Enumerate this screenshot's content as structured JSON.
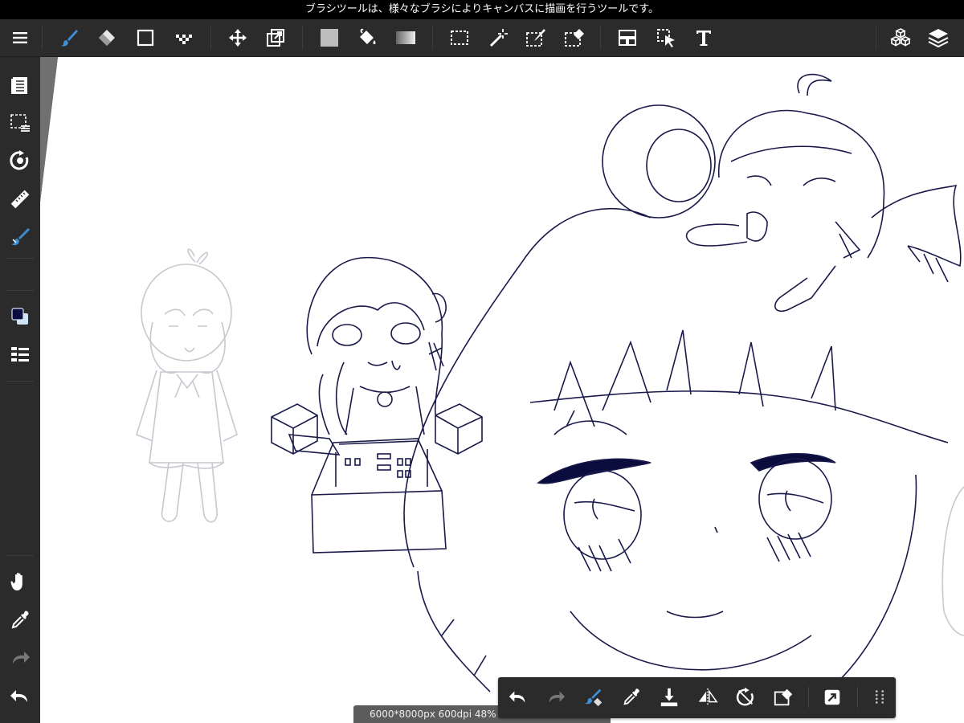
{
  "status_bar": {
    "message": "ブラシツールは、様々なブラシによりキャンバスに描画を行うツールです。"
  },
  "toolbar": {
    "items": [
      {
        "name": "menu-icon"
      },
      {
        "name": "brush-icon",
        "active": true
      },
      {
        "name": "eraser-icon"
      },
      {
        "name": "shape-icon"
      },
      {
        "name": "dot-icon"
      },
      {
        "name": "move-icon"
      },
      {
        "name": "transform-icon"
      },
      {
        "name": "fill-icon"
      },
      {
        "name": "bucket-icon"
      },
      {
        "name": "gradient-icon"
      },
      {
        "name": "select-icon"
      },
      {
        "name": "magic-wand-icon"
      },
      {
        "name": "select-pen-icon"
      },
      {
        "name": "select-eraser-icon"
      },
      {
        "name": "panel-icon"
      },
      {
        "name": "operation-icon"
      },
      {
        "name": "text-icon"
      },
      {
        "name": "material-icon"
      },
      {
        "name": "layers-icon"
      }
    ]
  },
  "sidebar": {
    "items": [
      {
        "name": "pages-icon"
      },
      {
        "name": "selection-list-icon"
      },
      {
        "name": "rotate-canvas-icon"
      },
      {
        "name": "ruler-icon"
      },
      {
        "name": "brush-settings-icon"
      },
      {
        "name": "color-swatch"
      },
      {
        "name": "layer-list-icon"
      },
      {
        "name": "hand-icon"
      },
      {
        "name": "eyedropper-icon"
      },
      {
        "name": "redo-icon"
      },
      {
        "name": "undo-icon"
      }
    ]
  },
  "colors": {
    "foreground": "#0b0c3e",
    "background": "#cfe4f6",
    "accent": "#3d8fd6",
    "line": "#1a1a4a",
    "sketch": "#c8c8d0"
  },
  "canvas_info": {
    "text": "6000*8000px 600dpi 48% ∠"
  },
  "quick_bar": {
    "items": [
      {
        "name": "undo-icon"
      },
      {
        "name": "redo-icon"
      },
      {
        "name": "brush-eraser-toggle-icon"
      },
      {
        "name": "eyedropper-icon"
      },
      {
        "name": "download-icon"
      },
      {
        "name": "flip-icon"
      },
      {
        "name": "rotate-reset-icon"
      },
      {
        "name": "clear-icon"
      },
      {
        "name": "send-icon"
      },
      {
        "name": "grid-icon"
      }
    ]
  }
}
